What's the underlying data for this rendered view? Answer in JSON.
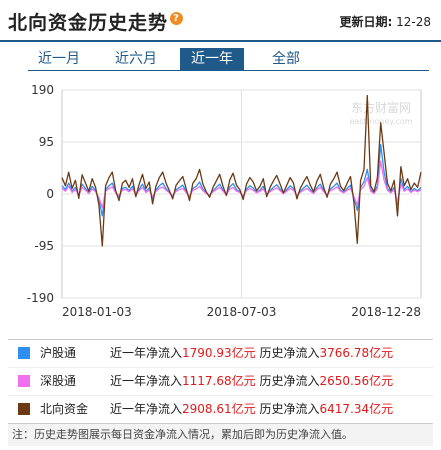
{
  "header": {
    "title": "北向资金历史走势",
    "help_icon": "?",
    "update_label": "更新日期:",
    "update_value": "12-28"
  },
  "tabs": [
    {
      "label": "近一月",
      "active": false
    },
    {
      "label": "近六月",
      "active": false
    },
    {
      "label": "近一年",
      "active": true
    },
    {
      "label": "全部",
      "active": false
    }
  ],
  "watermark": "东方财富网\neastmoney.com",
  "legend": [
    {
      "name": "沪股通",
      "color": "#2e8ff0",
      "period_label": "近一年净流入",
      "period_value": "1790.93亿元",
      "hist_label": "历史净流入",
      "hist_value": "3766.78亿元"
    },
    {
      "name": "深股通",
      "color": "#f070f0",
      "period_label": "近一年净流入",
      "period_value": "1117.68亿元",
      "hist_label": "历史净流入",
      "hist_value": "2650.56亿元"
    },
    {
      "name": "北向资金",
      "color": "#6b3a14",
      "period_label": "近一年净流入",
      "period_value": "2908.61亿元",
      "hist_label": "历史净流入",
      "hist_value": "6417.34亿元"
    }
  ],
  "note": "注：历史走势图展示每日资金净流入情况，累加后即为历史净流入值。",
  "chart_data": {
    "type": "line",
    "ylim": [
      -190,
      190
    ],
    "yticks": [
      190,
      95,
      0,
      -95,
      -190
    ],
    "xticks": [
      "2018-01-03",
      "2018-07-03",
      "2018-12-28"
    ],
    "grid": true,
    "series": [
      {
        "name": "沪股通",
        "color": "#2e8ff0",
        "values": [
          15,
          8,
          20,
          5,
          12,
          -3,
          18,
          10,
          2,
          14,
          6,
          -10,
          -40,
          8,
          15,
          20,
          3,
          -5,
          10,
          12,
          6,
          14,
          -2,
          9,
          18,
          5,
          11,
          -8,
          7,
          15,
          20,
          10,
          3,
          -4,
          8,
          12,
          16,
          5,
          -6,
          10,
          14,
          22,
          9,
          2,
          -3,
          6,
          12,
          18,
          7,
          -1,
          13,
          19,
          8,
          4,
          -5,
          9,
          15,
          11,
          3,
          7,
          14,
          -2,
          6,
          12,
          17,
          9,
          1,
          8,
          15,
          10,
          -4,
          5,
          11,
          16,
          8,
          2,
          12,
          18,
          6,
          -3,
          9,
          14,
          20,
          7,
          3,
          10,
          16,
          -7,
          -30,
          12,
          22,
          45,
          8,
          2,
          15,
          90,
          40,
          10,
          3,
          12,
          -20,
          28,
          8,
          14,
          4,
          10,
          6,
          12
        ]
      },
      {
        "name": "深股通",
        "color": "#f070f0",
        "values": [
          10,
          5,
          14,
          3,
          8,
          -2,
          12,
          7,
          1,
          9,
          4,
          -6,
          -25,
          5,
          10,
          13,
          2,
          -3,
          7,
          8,
          4,
          9,
          -1,
          6,
          12,
          3,
          7,
          -5,
          5,
          10,
          13,
          7,
          2,
          -3,
          5,
          8,
          10,
          3,
          -4,
          7,
          9,
          14,
          6,
          1,
          -2,
          4,
          8,
          12,
          5,
          -1,
          9,
          12,
          5,
          3,
          -3,
          6,
          10,
          7,
          2,
          5,
          9,
          -1,
          4,
          8,
          11,
          6,
          1,
          5,
          10,
          7,
          -3,
          3,
          7,
          10,
          5,
          1,
          8,
          12,
          4,
          -2,
          6,
          9,
          13,
          5,
          2,
          7,
          10,
          -5,
          -20,
          8,
          14,
          30,
          5,
          1,
          10,
          60,
          25,
          7,
          2,
          8,
          -15,
          18,
          5,
          9,
          3,
          7,
          4,
          8
        ]
      },
      {
        "name": "北向资金",
        "color": "#6b3a14",
        "values": [
          30,
          15,
          40,
          10,
          25,
          -8,
          35,
          20,
          5,
          28,
          12,
          -20,
          -95,
          15,
          30,
          40,
          6,
          -12,
          20,
          25,
          12,
          28,
          -5,
          18,
          36,
          10,
          22,
          -18,
          14,
          30,
          40,
          20,
          6,
          -9,
          16,
          24,
          32,
          10,
          -12,
          20,
          28,
          45,
          18,
          4,
          -6,
          12,
          24,
          36,
          14,
          -3,
          26,
          38,
          16,
          8,
          -10,
          18,
          30,
          22,
          6,
          14,
          28,
          -5,
          12,
          24,
          34,
          18,
          2,
          16,
          30,
          20,
          -9,
          10,
          22,
          32,
          16,
          4,
          24,
          36,
          12,
          -6,
          18,
          28,
          40,
          14,
          6,
          20,
          32,
          -15,
          -90,
          25,
          45,
          180,
          15,
          4,
          30,
          130,
          75,
          20,
          6,
          25,
          -40,
          50,
          15,
          28,
          8,
          20,
          12,
          40
        ]
      }
    ]
  }
}
